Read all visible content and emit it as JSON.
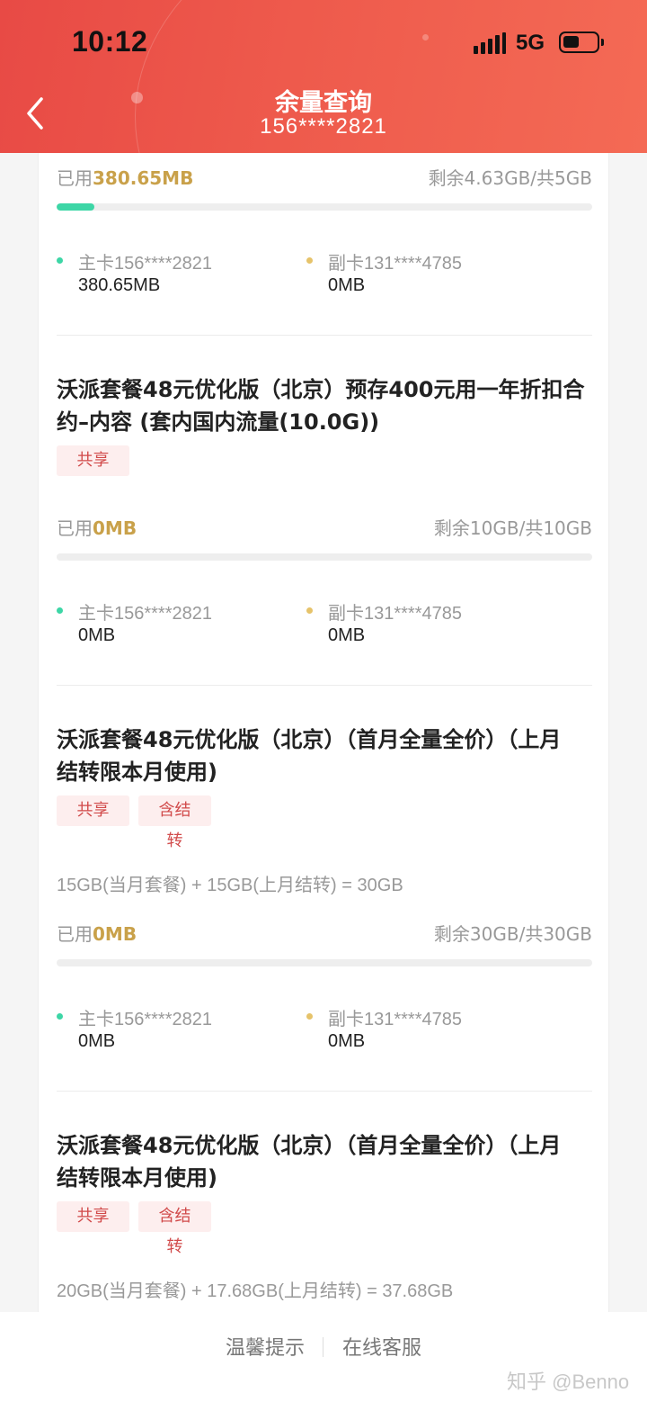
{
  "status_bar": {
    "time": "10:12",
    "network": "5G"
  },
  "header": {
    "title": "余量查询",
    "subtitle": "156****2821"
  },
  "sections": [
    {
      "used_prefix": "已用",
      "used_value": "380.65MB",
      "remaining": "剩余4.63GB/共5GB",
      "progress_fraction": 0.07,
      "members": [
        {
          "label": "主卡156****2821",
          "value": "380.65MB",
          "dot_color": "#3dd6a6"
        },
        {
          "label": "副卡131****4785",
          "value": "0MB",
          "dot_color": "#e6c36a"
        }
      ]
    },
    {
      "title_line1": "沃派套餐48元优化版（北京）预存400元用一年折扣合",
      "title_line2": "约–内容 (套内国内流量(10.0G))",
      "tags": [
        "共享"
      ],
      "used_prefix": "已用",
      "used_value": "0MB",
      "remaining": "剩余10GB/共10GB",
      "progress_fraction": 0,
      "members": [
        {
          "label": "主卡156****2821",
          "value": "0MB",
          "dot_color": "#3dd6a6"
        },
        {
          "label": "副卡131****4785",
          "value": "0MB",
          "dot_color": "#e6c36a"
        }
      ]
    },
    {
      "title_line1": "沃派套餐48元优化版（北京）（首月全量全价）（上月",
      "title_line2": "结转限本月使用)",
      "tags": [
        "共享",
        "含结转"
      ],
      "formula": "15GB(当月套餐) + 15GB(上月结转) = 30GB",
      "used_prefix": "已用",
      "used_value": "0MB",
      "remaining": "剩余30GB/共30GB",
      "progress_fraction": 0,
      "members": [
        {
          "label": "主卡156****2821",
          "value": "0MB",
          "dot_color": "#3dd6a6"
        },
        {
          "label": "副卡131****4785",
          "value": "0MB",
          "dot_color": "#e6c36a"
        }
      ]
    },
    {
      "title_line1": "沃派套餐48元优化版（北京）（首月全量全价）（上月",
      "title_line2": "结转限本月使用)",
      "tags": [
        "共享",
        "含结转"
      ],
      "formula": "20GB(当月套餐) + 17.68GB(上月结转) = 37.68GB"
    }
  ],
  "bottom_bar": {
    "tip_label": "温馨提示",
    "service_label": "在线客服"
  },
  "watermark": "知乎 @Benno",
  "colors": {
    "header": "#ee5a4c",
    "used_value": "#c9a14a",
    "progress": "#3dd6a6",
    "tag_bg": "#fdeeee",
    "tag_text": "#d14a4a"
  }
}
